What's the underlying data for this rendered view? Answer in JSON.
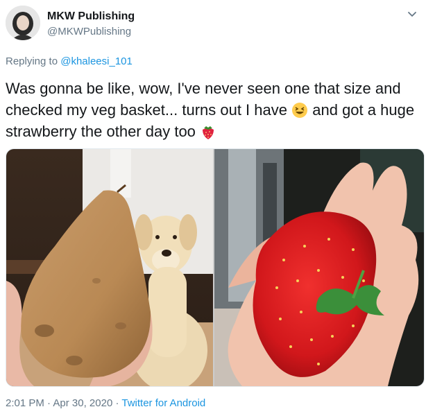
{
  "author": {
    "name": "MKW Publishing",
    "handle": "@MKWPublishing"
  },
  "reply": {
    "prefix": "Replying to",
    "to": "@khaleesi_101"
  },
  "tweet": {
    "part1": "Was gonna be like, wow, I've never seen one that size and checked my veg basket... turns out I have",
    "part2": "and got a huge strawberry the other day too"
  },
  "icons": [
    "chevron-down-icon",
    "laughing-emoji-icon",
    "strawberry-emoji-icon"
  ],
  "meta": {
    "time": "2:01 PM",
    "sep1": "·",
    "date": "Apr 30, 2020",
    "sep2": "·",
    "source": "Twitter for Android"
  }
}
